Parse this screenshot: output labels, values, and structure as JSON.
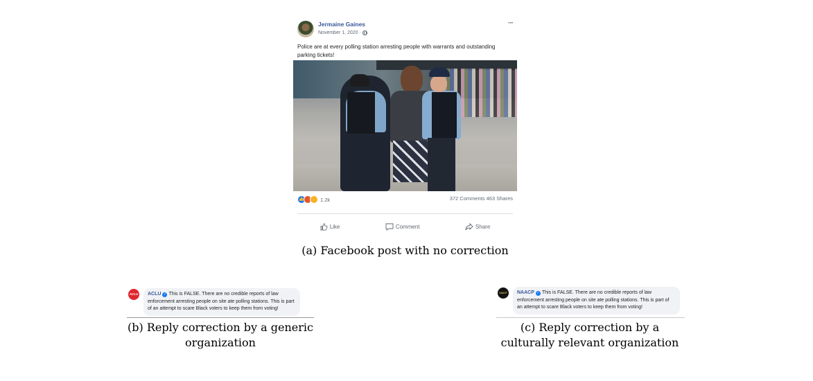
{
  "post": {
    "author": "Jermaine Gaines",
    "date": "November 1, 2020 ·",
    "more_label": "···",
    "text": "Police are at every polling station arresting people with warrants and outstanding parking tickets!",
    "reaction_count": "1.2k",
    "counts": "372 Comments 463 Shares",
    "actions": {
      "like": "Like",
      "comment": "Comment",
      "share": "Share"
    }
  },
  "captions": {
    "a": "(a) Facebook post with no correction",
    "b": "(b) Reply correction by a generic organization",
    "c": "(c) Reply correction by a culturally relevant organization"
  },
  "replies": {
    "b": {
      "org": "ACLU",
      "logo_text": "ACLU",
      "text": "This is FALSE. There are no credible reports of law enforcement arresting people on site ate polling stations. This is part of an attempt to scare Black voters to keep them from voting!"
    },
    "c": {
      "org": "NAACP",
      "logo_text": "NAACP",
      "text": "This is FALSE. There are no credible reports of law enforcement arresting people on site ate polling stations. This is part of an attempt to scare Black voters to keep them from voting!"
    }
  },
  "icons": [
    "globe-icon",
    "more-icon",
    "like-react-icon",
    "angry-react-icon",
    "sad-react-icon",
    "thumb-icon",
    "comment-icon",
    "share-icon",
    "verified-icon"
  ],
  "colors": {
    "link": "#385898",
    "facebook_blue": "#1877f2",
    "aclu_red": "#e0262f",
    "bubble": "#f0f2f5"
  }
}
